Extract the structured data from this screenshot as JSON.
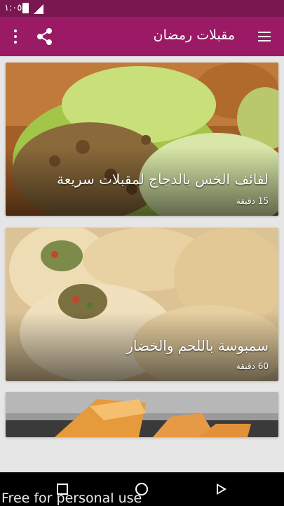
{
  "status_bar": {
    "time": "١:٠٥"
  },
  "app_bar": {
    "title": "مقبلات رمضان",
    "menu_icon": "hamburger-menu-icon",
    "share_icon": "share-icon",
    "more_icon": "more-vert-icon",
    "color": "#9b1a66",
    "status_color": "#7a1650"
  },
  "recipes": [
    {
      "title": "لفائف الخس بالدجاج لمقبلات سريعة",
      "time": "15 دقيقة"
    },
    {
      "title": "سمبوسة باللحم والخضار",
      "time": "60 دقيقة"
    },
    {
      "title": "",
      "time": ""
    }
  ],
  "nav_bar": {
    "back_icon": "back-triangle-icon",
    "home_icon": "home-circle-icon",
    "recents_icon": "recents-square-icon"
  },
  "watermark": "Free for personal use"
}
